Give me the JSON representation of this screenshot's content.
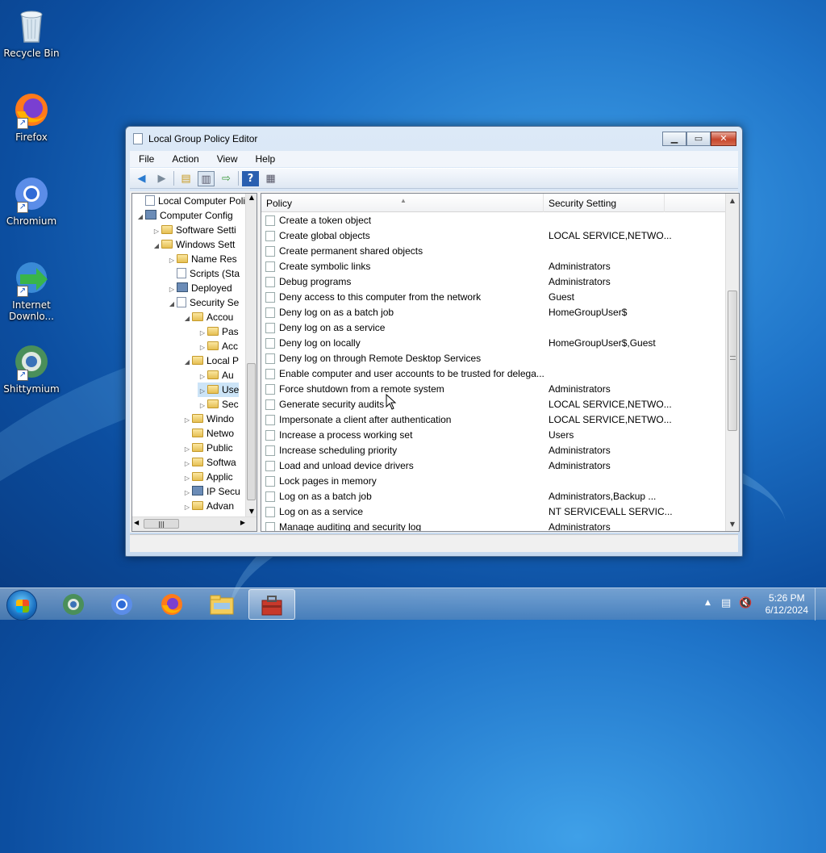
{
  "desktop": {
    "icons": [
      {
        "label": "Recycle Bin"
      },
      {
        "label": "Firefox"
      },
      {
        "label": "Chromium"
      },
      {
        "label": "Internet Downlo..."
      },
      {
        "label": "Shittymium"
      }
    ]
  },
  "window": {
    "title": "Local Group Policy Editor",
    "menu": [
      "File",
      "Action",
      "View",
      "Help"
    ],
    "tree": [
      {
        "label": "Local Computer Polic",
        "expander": "",
        "icon": "doc"
      },
      {
        "label": "Computer Config",
        "expander": "◢",
        "icon": "pc"
      },
      {
        "label": "Software Setti",
        "expander": "▷",
        "icon": "folder"
      },
      {
        "label": "Windows Sett",
        "expander": "◢",
        "icon": "folder"
      },
      {
        "label": "Name Res",
        "expander": "▷",
        "icon": "folder"
      },
      {
        "label": "Scripts (Sta",
        "expander": "",
        "icon": "doc"
      },
      {
        "label": "Deployed",
        "expander": "▷",
        "icon": "pc"
      },
      {
        "label": "Security Se",
        "expander": "◢",
        "icon": "doc"
      },
      {
        "label": "Accou",
        "expander": "◢",
        "icon": "lock"
      },
      {
        "label": "Pas",
        "expander": "▷",
        "icon": "lock"
      },
      {
        "label": "Acc",
        "expander": "▷",
        "icon": "lock"
      },
      {
        "label": "Local P",
        "expander": "◢",
        "icon": "lock"
      },
      {
        "label": "Au",
        "expander": "▷",
        "icon": "lock"
      },
      {
        "label": "Use",
        "expander": "▷",
        "icon": "lock"
      },
      {
        "label": "Sec",
        "expander": "▷",
        "icon": "lock"
      },
      {
        "label": "Windo",
        "expander": "▷",
        "icon": "folder"
      },
      {
        "label": "Netwo",
        "expander": "",
        "icon": "folder"
      },
      {
        "label": "Public",
        "expander": "▷",
        "icon": "folder"
      },
      {
        "label": "Softwa",
        "expander": "▷",
        "icon": "folder"
      },
      {
        "label": "Applic",
        "expander": "▷",
        "icon": "folder"
      },
      {
        "label": "IP Secu",
        "expander": "▷",
        "icon": "pc"
      },
      {
        "label": "Advan",
        "expander": "▷",
        "icon": "folder"
      }
    ],
    "columns": {
      "policy": "Policy",
      "setting": "Security Setting"
    },
    "rows": [
      {
        "policy": "Create a token object",
        "setting": ""
      },
      {
        "policy": "Create global objects",
        "setting": "LOCAL SERVICE,NETWO..."
      },
      {
        "policy": "Create permanent shared objects",
        "setting": ""
      },
      {
        "policy": "Create symbolic links",
        "setting": "Administrators"
      },
      {
        "policy": "Debug programs",
        "setting": "Administrators"
      },
      {
        "policy": "Deny access to this computer from the network",
        "setting": "Guest"
      },
      {
        "policy": "Deny log on as a batch job",
        "setting": "HomeGroupUser$"
      },
      {
        "policy": "Deny log on as a service",
        "setting": ""
      },
      {
        "policy": "Deny log on locally",
        "setting": "HomeGroupUser$,Guest"
      },
      {
        "policy": "Deny log on through Remote Desktop Services",
        "setting": ""
      },
      {
        "policy": "Enable computer and user accounts to be trusted for delega...",
        "setting": ""
      },
      {
        "policy": "Force shutdown from a remote system",
        "setting": "Administrators"
      },
      {
        "policy": "Generate security audits",
        "setting": "LOCAL SERVICE,NETWO..."
      },
      {
        "policy": "Impersonate a client after authentication",
        "setting": "LOCAL SERVICE,NETWO..."
      },
      {
        "policy": "Increase a process working set",
        "setting": "Users"
      },
      {
        "policy": "Increase scheduling priority",
        "setting": "Administrators"
      },
      {
        "policy": "Load and unload device drivers",
        "setting": "Administrators"
      },
      {
        "policy": "Lock pages in memory",
        "setting": ""
      },
      {
        "policy": "Log on as a batch job",
        "setting": "Administrators,Backup ..."
      },
      {
        "policy": "Log on as a service",
        "setting": "NT SERVICE\\ALL SERVIC..."
      },
      {
        "policy": "Manage auditing and security log",
        "setting": "Administrators"
      }
    ]
  },
  "taskbar": {
    "time": "5:26 PM",
    "date": "6/12/2024"
  }
}
